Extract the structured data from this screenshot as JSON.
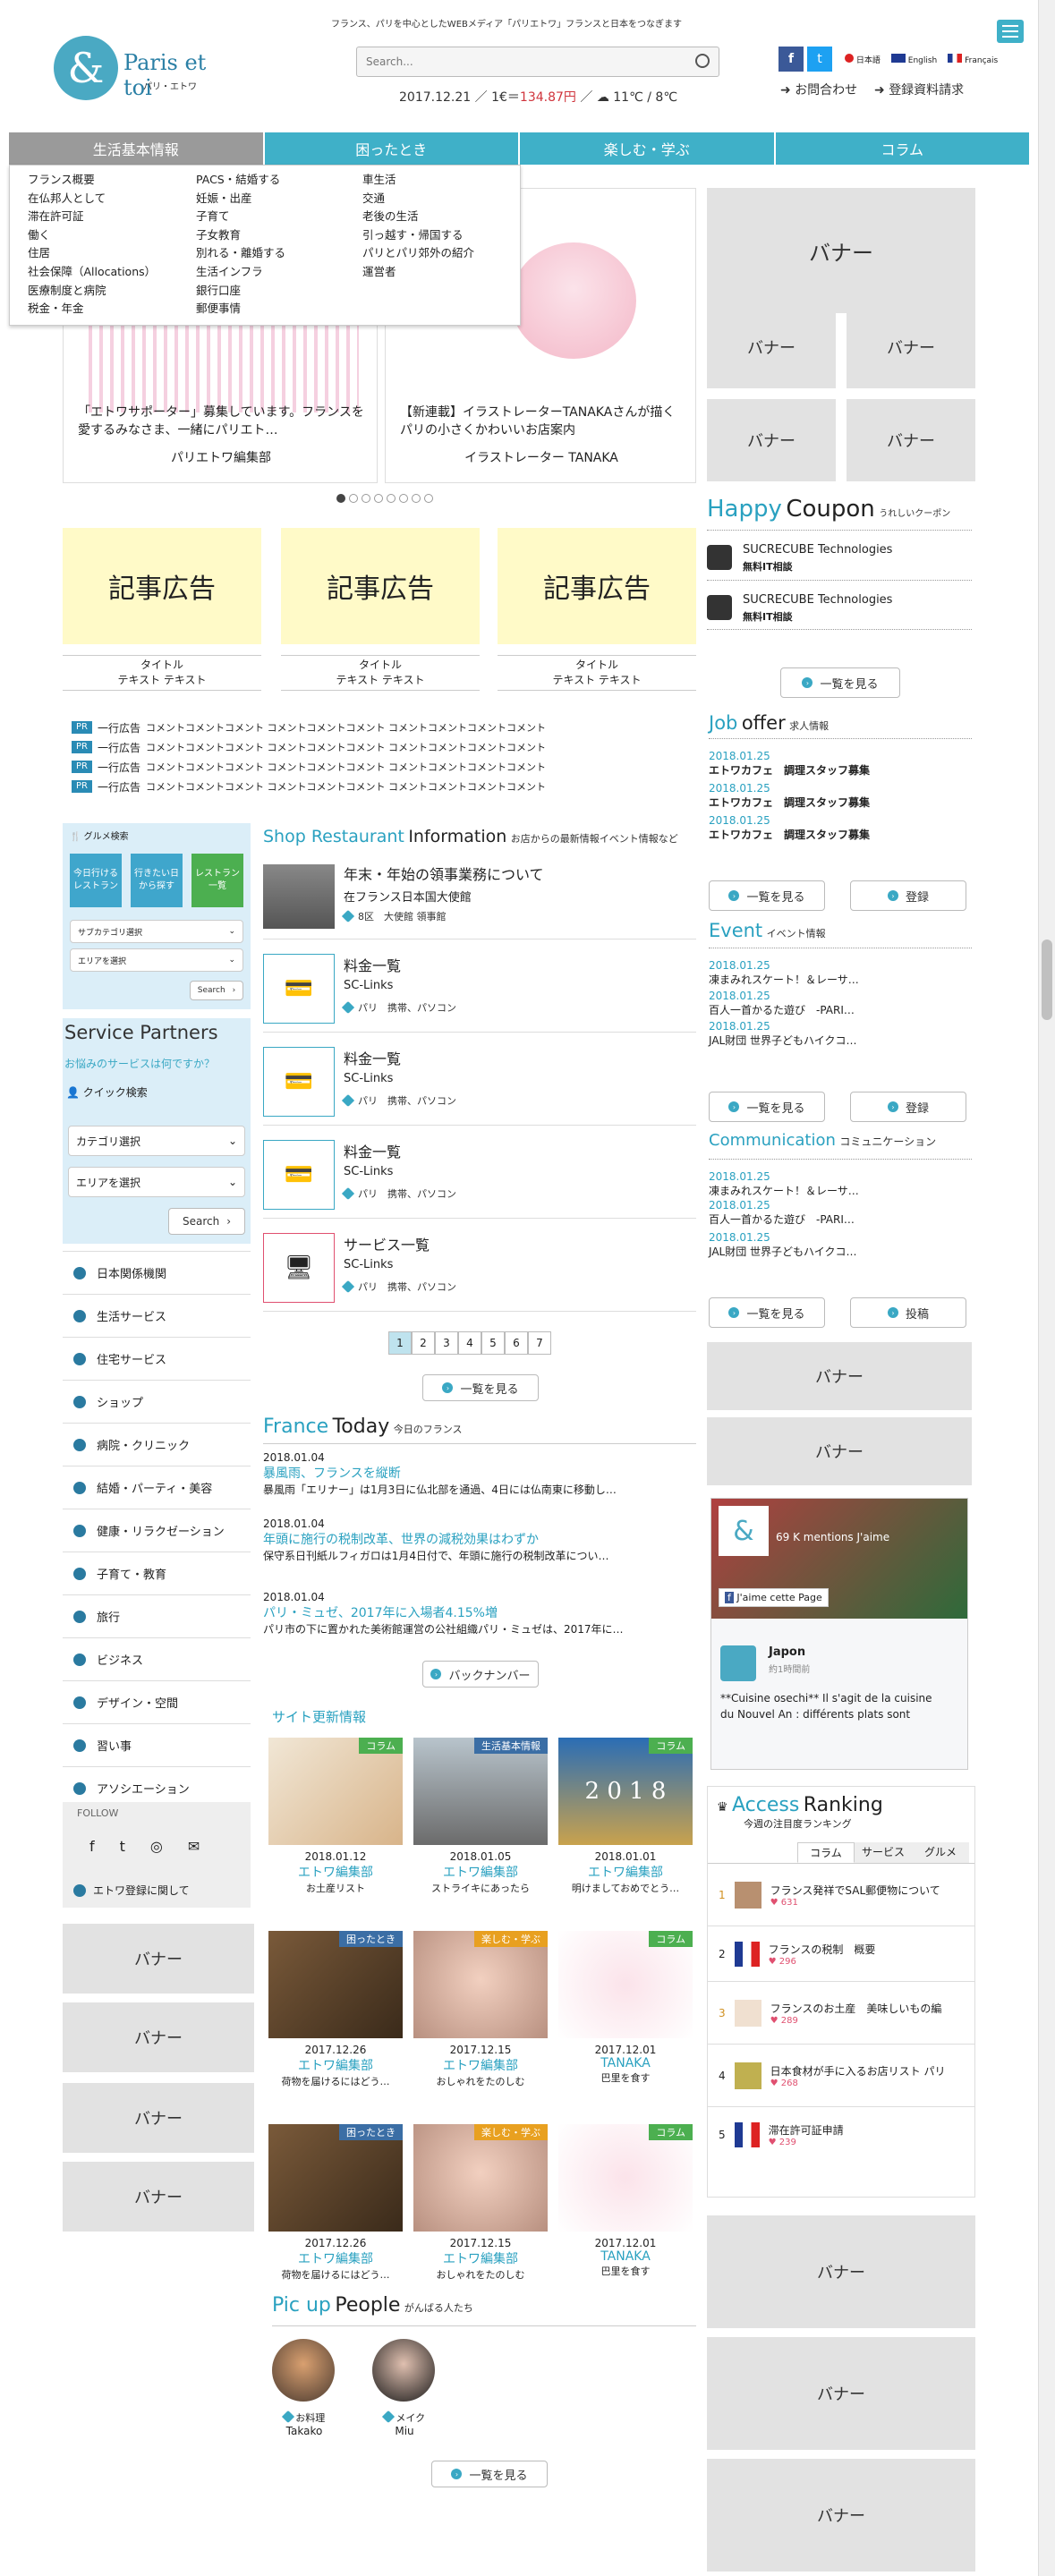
{
  "header": {
    "tagline": "フランス、パリを中心としたWEBメディア「パリエトワ」フランスと日本をつなぎます",
    "logo_text": "Paris et toi",
    "logo_sub": "パリ・エトワ",
    "search_placeholder": "Search...",
    "date": "2017.12.21",
    "rate_prefix": "1€＝",
    "rate": "134.87円",
    "weather": "11℃ / 8℃",
    "lang_ja": "日本語",
    "lang_en": "English",
    "lang_fr": "Français",
    "contact": "お問合わせ",
    "register": "登録資料請求"
  },
  "nav": [
    "生活基本情報",
    "困ったとき",
    "楽しむ・学ぶ",
    "コラム"
  ],
  "menu": {
    "col1": [
      "フランス概要",
      "在仏邦人として",
      "滞在許可証",
      "働く",
      "住居",
      "社会保障（Allocations）",
      "医療制度と病院",
      "税金・年金"
    ],
    "col2": [
      "PACS・結婚する",
      "妊娠・出産",
      "子育て",
      "子女教育",
      "別れる・離婚する",
      "生活インフラ",
      "銀行口座",
      "郵便事情"
    ],
    "col3": [
      "車生活",
      "交通",
      "老後の生活",
      "引っ越す・帰国する",
      "パリとパリ郊外の紹介",
      "運営者"
    ]
  },
  "slider": [
    {
      "title": "「エトワサポーター」募集しています。フランスを愛するみなさま、一緒にパリエト…",
      "author": "パリエトワ編集部"
    },
    {
      "title": "【新連載】イラストレーターTANAKAさんが描くパリの小さくかわいいお店案内",
      "author": "イラストレーター TANAKA"
    }
  ],
  "ads": [
    {
      "label": "記事広告",
      "title": "タイトル",
      "text": "テキスト テキスト"
    },
    {
      "label": "記事広告",
      "title": "タイトル",
      "text": "テキスト テキスト"
    },
    {
      "label": "記事広告",
      "title": "タイトル",
      "text": "テキスト テキスト"
    }
  ],
  "pr": {
    "badge": "PR",
    "label": "一行広告",
    "text": "コメントコメントコメント コメントコメントコメント コメントコメントコメントコメント"
  },
  "gourmet": {
    "title": "グルメ検索",
    "tiles": [
      "今日行けるレストラン",
      "行きたい日から探す",
      "レストラン一覧"
    ],
    "sub_select": "サブカテゴリ選択",
    "area_select": "エリアを選択",
    "search": "Search"
  },
  "service": {
    "title": "Service Partners",
    "question": "お悩みのサービスは何ですか？",
    "quick": "クイック検索",
    "category": "カテゴリ選択",
    "area": "エリアを選択",
    "search": "Search"
  },
  "left_menu": [
    "日本関係機関",
    "生活サービス",
    "住宅サービス",
    "ショップ",
    "病院・クリニック",
    "結婚・パーティ・美容",
    "健康・リラクゼーション",
    "子育て・教育",
    "旅行",
    "ビジネス",
    "デザイン・空間",
    "習い事",
    "アソシエーション"
  ],
  "follow": "FOLLOW",
  "etoile_register": "エトワ登録に関して",
  "left_banners": [
    "バナー",
    "バナー",
    "バナー",
    "バナー"
  ],
  "shop": {
    "title_a": "Shop Restaurant",
    "title_b": "Information",
    "sub": "お店からの最新情報イベント情報など",
    "items": [
      {
        "title": "年末・年始の領事業務について",
        "org": "在フランス日本国大使館",
        "tags": "8区　大使館 領事館"
      },
      {
        "title": "料金一覧",
        "org": "SC-Links",
        "tags": "パリ　携帯、パソコン"
      },
      {
        "title": "料金一覧",
        "org": "SC-Links",
        "tags": "パリ　携帯、パソコン"
      },
      {
        "title": "料金一覧",
        "org": "SC-Links",
        "tags": "パリ　携帯、パソコン"
      },
      {
        "title": "サービス一覧",
        "org": "SC-Links",
        "tags": "パリ　携帯、パソコン"
      }
    ],
    "pages": [
      "1",
      "2",
      "3",
      "4",
      "5",
      "6",
      "7"
    ],
    "more": "一覧を見る"
  },
  "france_today": {
    "title_a": "France",
    "title_b": "Today",
    "sub": "今日のフランス",
    "items": [
      {
        "date": "2018.01.04",
        "title": "暴風雨、フランスを縦断",
        "text": "暴風雨「エリナー」は1月3日に仏北部を通過、4日には仏南東に移動し…"
      },
      {
        "date": "2018.01.04",
        "title": "年頭に施行の税制改革、世界の減税効果はわずか",
        "text": "保守系日刊紙ルフィガロは1月4日付で、年頭に施行の税制改革につい…"
      },
      {
        "date": "2018.01.04",
        "title": "パリ・ミュゼ、2017年に入場者4.15%増",
        "text": "パリ市の下に置かれた美術館運営の公社組織パリ・ミュゼは、2017年に…"
      }
    ],
    "backnumber": "バックナンバー"
  },
  "site_updates": {
    "title": "サイト更新情報",
    "items": [
      {
        "tag": "コラム",
        "date": "2018.01.12",
        "author": "エトワ編集部",
        "text": "お土産リスト"
      },
      {
        "tag": "生活基本情報",
        "date": "2018.01.05",
        "author": "エトワ編集部",
        "text": "ストライキにあったら"
      },
      {
        "tag": "コラム",
        "date": "2018.01.01",
        "author": "エトワ編集部",
        "text": "明けましておめでとう…",
        "img_text": "2 0 1 8"
      },
      {
        "tag": "困ったとき",
        "date": "2017.12.26",
        "author": "エトワ編集部",
        "text": "荷物を届けるにはどう…"
      },
      {
        "tag": "楽しむ・学ぶ",
        "date": "2017.12.15",
        "author": "エトワ編集部",
        "text": "おしゃれをたのしむ"
      },
      {
        "tag": "コラム",
        "date": "2017.12.01",
        "author": "TANAKA",
        "text": "巴里を食す"
      },
      {
        "tag": "困ったとき",
        "date": "2017.12.26",
        "author": "エトワ編集部",
        "text": "荷物を届けるにはどう…"
      },
      {
        "tag": "楽しむ・学ぶ",
        "date": "2017.12.15",
        "author": "エトワ編集部",
        "text": "おしゃれをたのしむ"
      },
      {
        "tag": "コラム",
        "date": "2017.12.01",
        "author": "TANAKA",
        "text": "巴里を食す"
      }
    ]
  },
  "pickup": {
    "title_a": "Pic up",
    "title_b": "People",
    "sub": "がんばる人たち",
    "people": [
      {
        "role": "お料理",
        "name": "Takako"
      },
      {
        "role": "メイク",
        "name": "Miu"
      }
    ],
    "more": "一覧を見る"
  },
  "right": {
    "banner_big": "バナー",
    "banner_small": [
      "バナー",
      "バナー",
      "バナー",
      "バナー"
    ],
    "coupon_title_a": "Happy",
    "coupon_title_b": "Coupon",
    "coupon_sub": "うれしいクーポン",
    "coupons": [
      {
        "name": "SUCRECUBE Technologies",
        "desc": "無料IT相談"
      },
      {
        "name": "SUCRECUBE Technologies",
        "desc": "無料IT相談"
      }
    ],
    "coupon_more": "一覧を見る",
    "job_title_a": "Job",
    "job_title_b": "offer",
    "job_sub": "求人情報",
    "jobs": [
      {
        "date": "2018.01.25",
        "text": "エトワカフェ　調理スタッフ募集"
      },
      {
        "date": "2018.01.25",
        "text": "エトワカフェ　調理スタッフ募集"
      },
      {
        "date": "2018.01.25",
        "text": "エトワカフェ　調理スタッフ募集"
      }
    ],
    "job_more": "一覧を見る",
    "job_register": "登録",
    "event_title": "Event",
    "event_sub": "イベント情報",
    "events": [
      {
        "date": "2018.01.25",
        "text": "凍まみれスケート！＆レーサ…"
      },
      {
        "date": "2018.01.25",
        "text": "百人一首かるた遊び　-PARI…"
      },
      {
        "date": "2018.01.25",
        "text": "JAL財団 世界子どもハイクコ…"
      }
    ],
    "event_more": "一覧を見る",
    "event_register": "登録",
    "comm_title": "Communication",
    "comm_sub": "コミュニケーション",
    "comms": [
      {
        "date": "2018.01.25",
        "text": "凍まみれスケート！＆レーサ…"
      },
      {
        "date": "2018.01.25",
        "text": "百人一首かるた遊び　-PARI…"
      },
      {
        "date": "2018.01.25",
        "text": "JAL財団 世界子どもハイクコ…"
      }
    ],
    "comm_more": "一覧を見る",
    "comm_post": "投稿",
    "banners_mid": [
      "バナー",
      "バナー"
    ],
    "fb_likes": "69 K mentions J'aime",
    "fb_like_btn": "J'aime cette Page",
    "fb_name": "Japon",
    "fb_time": "約1時間前",
    "fb_post": "**Cuisine osechi** Il s'agit de la cuisine du Nouvel An : différents plats sont",
    "access_title_a": "Access",
    "access_title_b": "Ranking",
    "access_sub": "今週の注目度ランキング",
    "tabs": [
      "コラム",
      "サービス",
      "グルメ"
    ],
    "ranks": [
      {
        "n": "1",
        "text": "フランス発祥でSAL郵便物について",
        "count": "631"
      },
      {
        "n": "2",
        "text": "フランスの税制　概要",
        "count": "296"
      },
      {
        "n": "3",
        "text": "フランスのお土産　美味しいもの編",
        "count": "289"
      },
      {
        "n": "4",
        "text": "日本食材が手に入るお店リスト パリ",
        "count": "268"
      },
      {
        "n": "5",
        "text": "滞在許可証申請",
        "count": "239"
      }
    ],
    "banners_bottom": [
      "バナー",
      "バナー",
      "バナー"
    ]
  },
  "colors": {
    "accent": "#3fb0c8",
    "price": "#d0343c",
    "ad_bg": "#fffac8",
    "banner": "#e2e2e2",
    "green_tag": "#4caf50",
    "blue_tag": "#3b6ea5",
    "orange_tag": "#e8a020"
  }
}
